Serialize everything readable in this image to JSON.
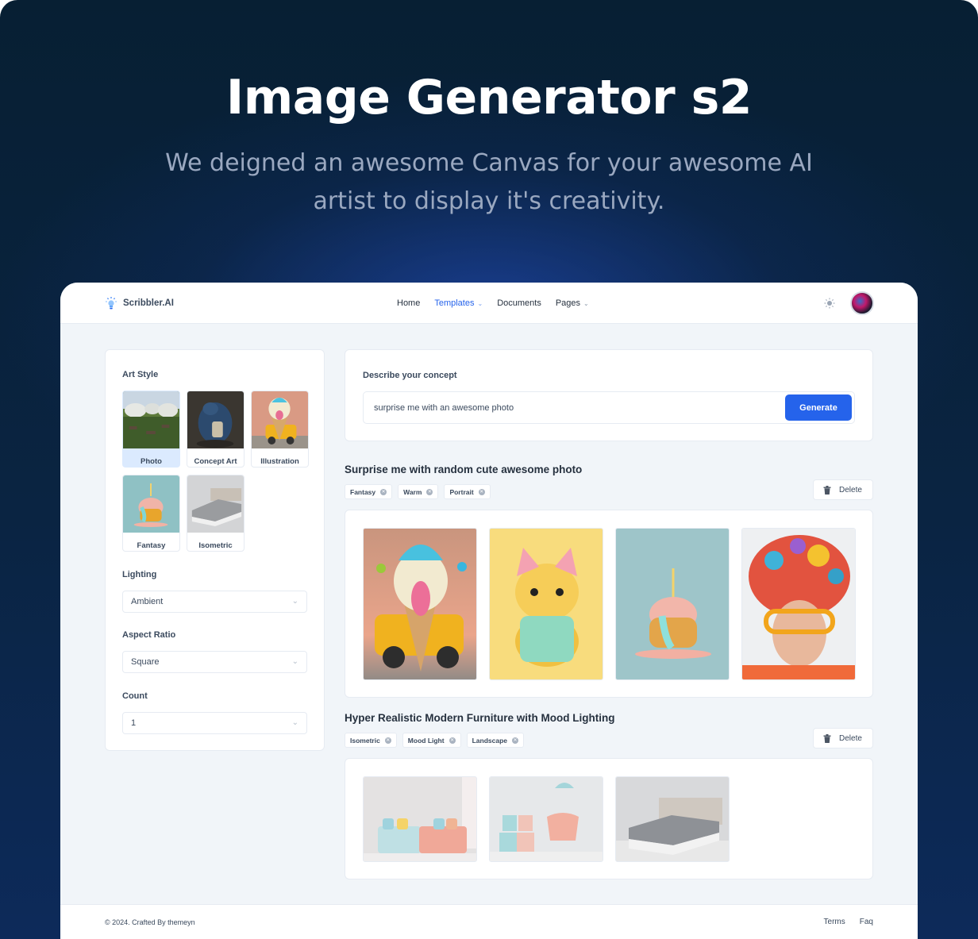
{
  "hero": {
    "title": "Image Generator s2",
    "subtitle": "We deigned an awesome Canvas for your awesome AI artist to display it's creativity."
  },
  "navbar": {
    "brand": "Scribbler.AI",
    "items": [
      {
        "label": "Home",
        "has_dropdown": false,
        "active": false
      },
      {
        "label": "Templates",
        "has_dropdown": true,
        "active": true
      },
      {
        "label": "Documents",
        "has_dropdown": false,
        "active": false
      },
      {
        "label": "Pages",
        "has_dropdown": true,
        "active": false
      }
    ],
    "theme_icon": "sun-icon",
    "avatar_icon": "user-avatar"
  },
  "sidebar": {
    "art_style_label": "Art Style",
    "styles": [
      {
        "label": "Photo",
        "selected": true
      },
      {
        "label": "Concept Art",
        "selected": false
      },
      {
        "label": "Illustration",
        "selected": false
      },
      {
        "label": "Fantasy",
        "selected": false
      },
      {
        "label": "Isometric",
        "selected": false
      }
    ],
    "lighting": {
      "label": "Lighting",
      "value": "Ambient"
    },
    "aspect_ratio": {
      "label": "Aspect Ratio",
      "value": "Square"
    },
    "count": {
      "label": "Count",
      "value": "1"
    }
  },
  "concept": {
    "label": "Describe your concept",
    "input_value": "surprise me with an awesome photo",
    "generate_label": "Generate"
  },
  "results": [
    {
      "title": "Surprise me with random cute awesome photo",
      "tags": [
        "Fantasy",
        "Warm",
        "Portrait"
      ],
      "delete_label": "Delete",
      "images": [
        "ice-cream-car",
        "yellow-cat-calculator",
        "melting-cupcake-candle",
        "colorful-head-glasses"
      ]
    },
    {
      "title": "Hyper Realistic Modern Furniture with Mood Lighting",
      "tags": [
        "Isometric",
        "Mood Light",
        "Landscape"
      ],
      "delete_label": "Delete",
      "images": [
        "pastel-sofa",
        "pink-armchair-lamps",
        "grey-bed"
      ]
    }
  ],
  "footer": {
    "copyright": "© 2024. Crafted By themeyn",
    "links": [
      "Terms",
      "Faq"
    ]
  },
  "colors": {
    "accent": "#2563eb",
    "selected_style_bg": "#dbeafe",
    "app_bg": "#f1f5f9",
    "hero_bg": "#071f33"
  }
}
